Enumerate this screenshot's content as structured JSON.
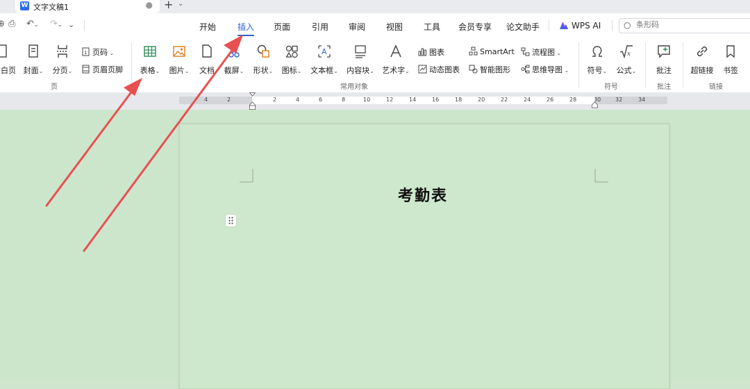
{
  "tab": {
    "app_letter": "W",
    "doc_name": "文字文稿1",
    "close_glyph": "●",
    "new_tab": "+",
    "tab_menu": "⌄"
  },
  "menu": {
    "items": [
      "开始",
      "插入",
      "页面",
      "引用",
      "审阅",
      "视图",
      "工具",
      "会员专享",
      "论文助手",
      "WPS AI"
    ],
    "active": "插入",
    "search_placeholder": "条形码"
  },
  "ribbon": {
    "page_group": {
      "label": "页",
      "buttons": [
        "空白页",
        "封面",
        "分页",
        "页码",
        "页眉页脚"
      ]
    },
    "objects_group": {
      "label": "常用对象",
      "buttons": [
        "表格",
        "图片",
        "文档",
        "截屏",
        "形状",
        "图标",
        "文本框",
        "内容块",
        "艺术字"
      ],
      "small": [
        "图表",
        "动态图表",
        "SmartArt",
        "智能图形",
        "流程图",
        "思维导图"
      ]
    },
    "symbol_group": {
      "label": "符号",
      "buttons": [
        "符号",
        "公式"
      ]
    },
    "comment_group": {
      "label": "批注",
      "buttons": [
        "批注"
      ]
    },
    "link_group": {
      "label": "链接",
      "buttons": [
        "超链接",
        "书签"
      ]
    }
  },
  "ruler": {
    "numbers": [
      "4",
      "2",
      "2",
      "4",
      "6",
      "8",
      "10",
      "12",
      "14",
      "16",
      "18",
      "20",
      "22",
      "24",
      "26",
      "28",
      "30",
      "32",
      "34"
    ]
  },
  "document": {
    "title": "考勤表"
  },
  "colors": {
    "accent": "#2f5fd6",
    "arrow": "#e8504f",
    "doc_bg": "#cce6cc",
    "wps_blue": "#2a6bf2"
  }
}
